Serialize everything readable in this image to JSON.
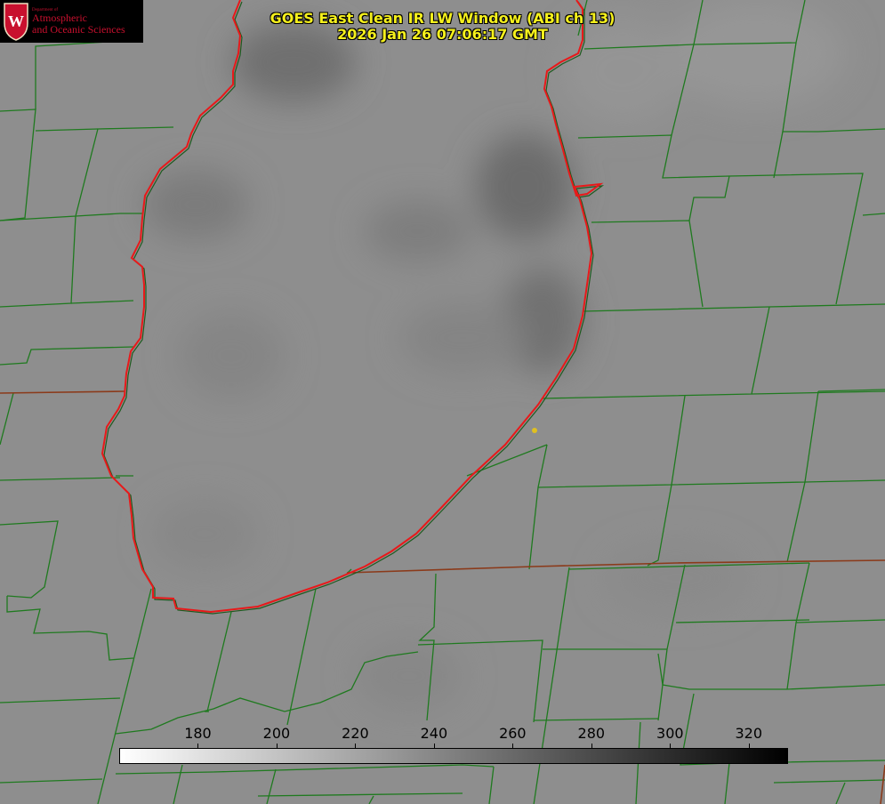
{
  "logo": {
    "dept": "Department of",
    "line1": "Atmospheric",
    "line2": "and Oceanic Sciences"
  },
  "title": {
    "line1": "GOES East Clean IR LW Window (ABI ch 13)",
    "line2": "2026 Jan 26 07:06:17 GMT"
  },
  "colorbar": {
    "min": 160,
    "max": 330,
    "ticks": [
      "180",
      "200",
      "220",
      "240",
      "260",
      "280",
      "300",
      "320"
    ],
    "tick_values": [
      180,
      200,
      220,
      240,
      260,
      280,
      300,
      320
    ],
    "start_color": "#ffffff",
    "end_color": "#000000"
  },
  "map": {
    "background_color": "#8e8e8e",
    "county_line_color": "#1f7a1f",
    "state_line_color": "#8b3a1a",
    "lake_outline_color": "#e8191a",
    "marker_color": "#e0c020"
  }
}
